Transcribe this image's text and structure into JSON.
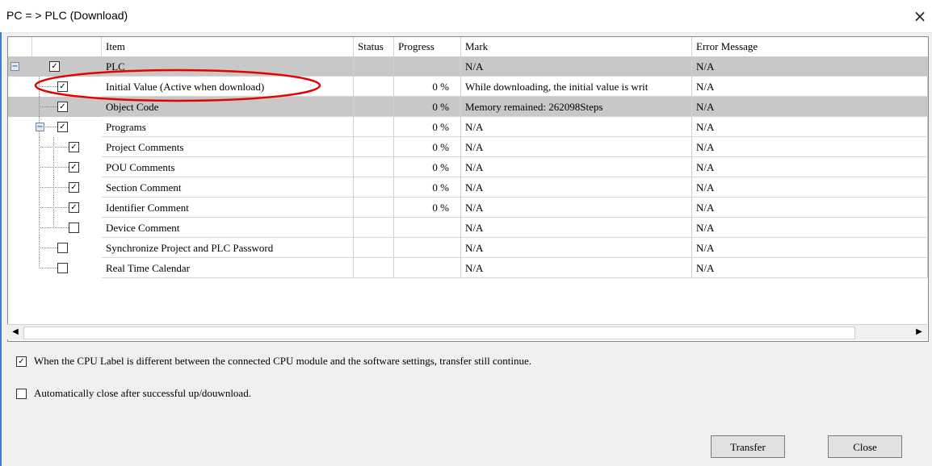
{
  "window": {
    "title": "PC = > PLC (Download)",
    "close_glyph": "×"
  },
  "table": {
    "headers": {
      "item": "Item",
      "status": "Status",
      "progress": "Progress",
      "mark": "Mark",
      "error": "Error Message"
    },
    "rows": [
      {
        "item": "PLC",
        "progress": "",
        "mark": "N/A",
        "error": "N/A",
        "checked": true,
        "highlight": true
      },
      {
        "item": "Initial Value (Active when download)",
        "progress": "0 %",
        "mark": "While downloading, the initial value is writ",
        "error": "N/A",
        "checked": true,
        "highlight": false
      },
      {
        "item": "Object Code",
        "progress": "0 %",
        "mark": "Memory remained: 262098Steps",
        "error": "N/A",
        "checked": true,
        "highlight": true
      },
      {
        "item": "Programs",
        "progress": "0 %",
        "mark": "N/A",
        "error": "N/A",
        "checked": true,
        "highlight": false
      },
      {
        "item": "Project Comments",
        "progress": "0 %",
        "mark": "N/A",
        "error": "N/A",
        "checked": true,
        "highlight": false
      },
      {
        "item": "POU Comments",
        "progress": "0 %",
        "mark": "N/A",
        "error": "N/A",
        "checked": true,
        "highlight": false
      },
      {
        "item": "Section Comment",
        "progress": "0 %",
        "mark": "N/A",
        "error": "N/A",
        "checked": true,
        "highlight": false
      },
      {
        "item": "Identifier Comment",
        "progress": "0 %",
        "mark": "N/A",
        "error": "N/A",
        "checked": true,
        "highlight": false
      },
      {
        "item": "Device Comment",
        "progress": "",
        "mark": "N/A",
        "error": "N/A",
        "checked": false,
        "highlight": false
      },
      {
        "item": "Synchronize Project and PLC Password",
        "progress": "",
        "mark": "N/A",
        "error": "N/A",
        "checked": false,
        "highlight": false
      },
      {
        "item": "Real Time Calendar",
        "progress": "",
        "mark": "N/A",
        "error": "N/A",
        "checked": false,
        "highlight": false
      }
    ]
  },
  "options": {
    "cpu_label": {
      "label": "When the CPU Label is different between the connected CPU module and the software settings, transfer still continue.",
      "checked": true
    },
    "auto_close": {
      "label": "Automatically close after successful up/douwnload.",
      "checked": false
    }
  },
  "buttons": {
    "transfer": "Transfer",
    "close": "Close"
  },
  "scrollbar": {
    "left_arrow": "◀",
    "right_arrow": "▶"
  },
  "glyphs": {
    "check": "✓",
    "minus": "−"
  },
  "colors": {
    "highlight_row": "#c8c8c8",
    "annotation": "#e60000",
    "window_accent": "#3b7fd4"
  }
}
